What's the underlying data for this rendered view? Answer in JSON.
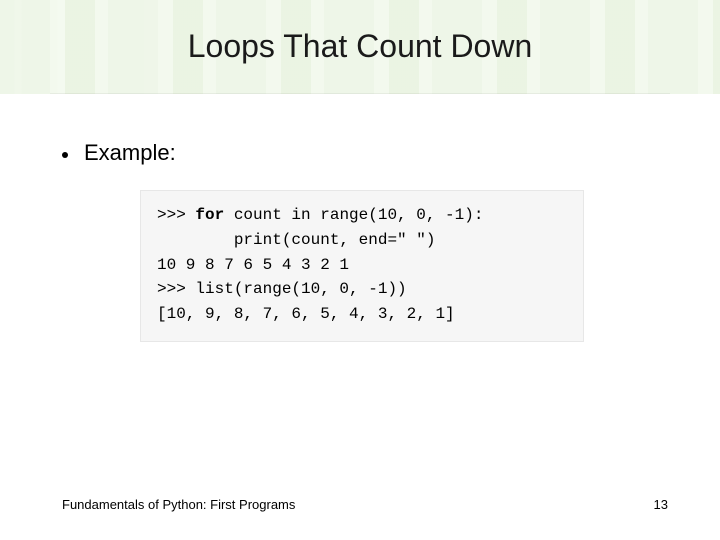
{
  "title": "Loops That Count Down",
  "bullet_label": "Example:",
  "code": {
    "line1_prompt": ">>> ",
    "line1_for": "for",
    "line1_rest": " count in range(10, 0, -1):",
    "line2": "        print(count, end=\" \")",
    "blank": "",
    "line3": "10 9 8 7 6 5 4 3 2 1",
    "line4": ">>> list(range(10, 0, -1))",
    "line5": "[10, 9, 8, 7, 6, 5, 4, 3, 2, 1]"
  },
  "footer": "Fundamentals of Python: First Programs",
  "page_number": "13"
}
